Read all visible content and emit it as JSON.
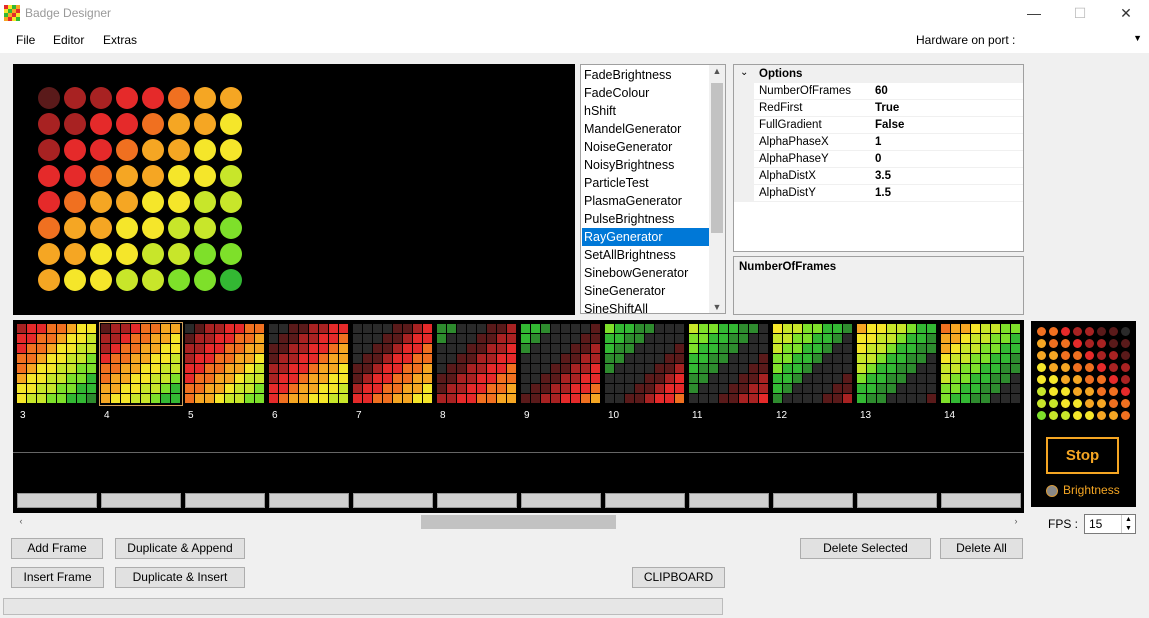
{
  "window": {
    "title": "Badge Designer",
    "minimize": "—",
    "maximize": "☐",
    "close": "✕"
  },
  "menu": {
    "file": "File",
    "editor": "Editor",
    "extras": "Extras"
  },
  "hardware": {
    "label": "Hardware on port :",
    "value": ""
  },
  "generators": {
    "items": [
      "FadeBrightness",
      "FadeColour",
      "hShift",
      "MandelGenerator",
      "NoiseGenerator",
      "NoisyBrightness",
      "ParticleTest",
      "PlasmaGenerator",
      "PulseBrightness",
      "RayGenerator",
      "SetAllBrightness",
      "SinebowGenerator",
      "SineGenerator",
      "SineShiftAll"
    ],
    "selected": "RayGenerator"
  },
  "properties": {
    "category": "Options",
    "rows": [
      {
        "name": "NumberOfFrames",
        "value": "60"
      },
      {
        "name": "RedFirst",
        "value": "True"
      },
      {
        "name": "FullGradient",
        "value": "False"
      },
      {
        "name": "AlphaPhaseX",
        "value": "1"
      },
      {
        "name": "AlphaPhaseY",
        "value": "0"
      },
      {
        "name": "AlphaDistX",
        "value": "3.5"
      },
      {
        "name": "AlphaDistY",
        "value": "1.5"
      }
    ],
    "description_title": "NumberOfFrames"
  },
  "frames": {
    "numbers": [
      "3",
      "4",
      "5",
      "6",
      "7",
      "8",
      "9",
      "10",
      "11",
      "12",
      "13",
      "14"
    ],
    "selected": "4"
  },
  "player": {
    "stop_label": "Stop",
    "brightness_label": "Brightness"
  },
  "fps": {
    "label": "FPS :",
    "value": "15"
  },
  "buttons": {
    "add_frame": "Add Frame",
    "duplicate_append": "Duplicate & Append",
    "insert_frame": "Insert Frame",
    "duplicate_insert": "Duplicate & Insert",
    "clipboard": "CLIPBOARD",
    "delete_selected": "Delete Selected",
    "delete_all": "Delete All"
  },
  "colors": {
    "off": "#2a2a2a",
    "dark_green": "#2e8b2e",
    "green": "#33b833",
    "lime": "#7ee02a",
    "yellow_green": "#c8e62a",
    "yellow": "#f5e62a",
    "orange": "#f5a623",
    "dark_orange": "#f07020",
    "red": "#e52a2a",
    "dark_red": "#a82222",
    "maroon": "#5a1a1a",
    "accent": "#0078d7"
  }
}
